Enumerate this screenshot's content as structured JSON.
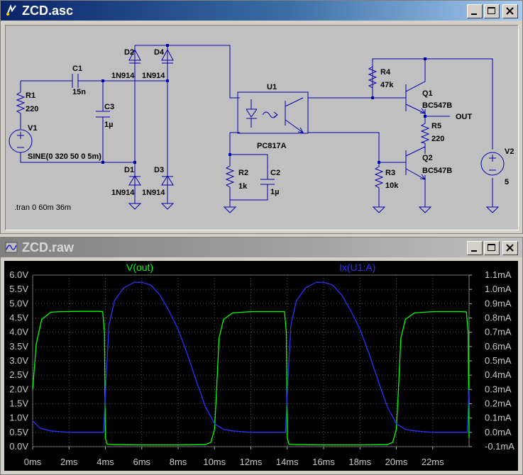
{
  "schematic_window": {
    "title": "ZCD.asc",
    "components": {
      "r1": {
        "name": "R1",
        "value": "220"
      },
      "v1": {
        "name": "V1",
        "value": "SINE(0 320 50 0 5m)"
      },
      "c1": {
        "name": "C1",
        "value": "15n"
      },
      "c3": {
        "name": "C3",
        "value": "1µ"
      },
      "d1": {
        "name": "D1",
        "value": "1N914"
      },
      "d2": {
        "name": "D2",
        "value": "1N914"
      },
      "d3": {
        "name": "D3",
        "value": "1N914"
      },
      "d4": {
        "name": "D4",
        "value": "1N914"
      },
      "u1": {
        "name": "U1",
        "value": "PC817A"
      },
      "r2": {
        "name": "R2",
        "value": "1k"
      },
      "c2": {
        "name": "C2",
        "value": "1µ"
      },
      "r3": {
        "name": "R3",
        "value": "10k"
      },
      "r4": {
        "name": "R4",
        "value": "47k"
      },
      "r5": {
        "name": "R5",
        "value": "220"
      },
      "q1": {
        "name": "Q1",
        "value": "BC547B"
      },
      "q2": {
        "name": "Q2",
        "value": "BC547B"
      },
      "v2": {
        "name": "V2",
        "value": "5"
      }
    },
    "net_label": "OUT",
    "directive": ".tran 0 60m 36m"
  },
  "waveform_window": {
    "title": "ZCD.raw",
    "trace_colors": {
      "vout": "#00ff00",
      "ix": "#3030ff"
    }
  },
  "chart_data": {
    "type": "line",
    "x_ticks": [
      "0ms",
      "2ms",
      "4ms",
      "6ms",
      "8ms",
      "10ms",
      "12ms",
      "14ms",
      "16ms",
      "18ms",
      "20ms",
      "22ms"
    ],
    "xlim": [
      0,
      24
    ],
    "left_axis": {
      "ylim": [
        0,
        6
      ],
      "ticks": [
        "0.0V",
        "0.5V",
        "1.0V",
        "1.5V",
        "2.0V",
        "2.5V",
        "3.0V",
        "3.5V",
        "4.0V",
        "4.5V",
        "5.0V",
        "5.5V",
        "6.0V"
      ]
    },
    "right_axis": {
      "ylim": [
        -0.1,
        1.1
      ],
      "ticks": [
        "-0.1mA",
        "0.0mA",
        "0.1mA",
        "0.2mA",
        "0.3mA",
        "0.4mA",
        "0.5mA",
        "0.6mA",
        "0.7mA",
        "0.8mA",
        "0.9mA",
        "1.0mA",
        "1.1mA"
      ]
    },
    "series": [
      {
        "name": "V(out)",
        "axis": "left",
        "color": "#00ff00",
        "points": [
          [
            0,
            2.0
          ],
          [
            0.2,
            3.6
          ],
          [
            0.5,
            4.45
          ],
          [
            1.0,
            4.7
          ],
          [
            1.5,
            4.72
          ],
          [
            2.5,
            4.73
          ],
          [
            3.6,
            4.73
          ],
          [
            3.85,
            4.72
          ],
          [
            3.95,
            4.0
          ],
          [
            4.0,
            0.3
          ],
          [
            4.1,
            0.08
          ],
          [
            4.6,
            0.07
          ],
          [
            6,
            0.06
          ],
          [
            8,
            0.06
          ],
          [
            9.5,
            0.07
          ],
          [
            9.8,
            0.15
          ],
          [
            10.0,
            0.6
          ],
          [
            10.1,
            1.8
          ],
          [
            10.25,
            3.8
          ],
          [
            10.5,
            4.45
          ],
          [
            11.0,
            4.68
          ],
          [
            12,
            4.72
          ],
          [
            13.5,
            4.72
          ],
          [
            13.85,
            4.72
          ],
          [
            13.95,
            4.0
          ],
          [
            14.0,
            0.3
          ],
          [
            14.1,
            0.08
          ],
          [
            14.6,
            0.07
          ],
          [
            16,
            0.06
          ],
          [
            18,
            0.06
          ],
          [
            19.5,
            0.07
          ],
          [
            19.8,
            0.15
          ],
          [
            20.0,
            0.6
          ],
          [
            20.1,
            1.8
          ],
          [
            20.25,
            3.8
          ],
          [
            20.5,
            4.45
          ],
          [
            21.0,
            4.68
          ],
          [
            22,
            4.72
          ],
          [
            23.6,
            4.72
          ],
          [
            23.85,
            4.71
          ],
          [
            23.95,
            4.0
          ],
          [
            24.0,
            0.3
          ]
        ]
      },
      {
        "name": "Ix(U1:A)",
        "axis": "right",
        "color": "#3030ff",
        "points": [
          [
            0,
            0.08
          ],
          [
            0.4,
            0.03
          ],
          [
            1.0,
            0.01
          ],
          [
            2,
            0.0
          ],
          [
            3.5,
            0.0
          ],
          [
            3.9,
            0.0
          ],
          [
            4.05,
            0.4
          ],
          [
            4.2,
            0.75
          ],
          [
            4.5,
            0.92
          ],
          [
            5,
            1.01
          ],
          [
            5.6,
            1.05
          ],
          [
            6,
            1.05
          ],
          [
            6.5,
            1.03
          ],
          [
            7,
            0.96
          ],
          [
            7.5,
            0.85
          ],
          [
            8,
            0.72
          ],
          [
            8.5,
            0.55
          ],
          [
            9,
            0.36
          ],
          [
            9.5,
            0.18
          ],
          [
            10,
            0.06
          ],
          [
            10.5,
            0.02
          ],
          [
            11,
            0.01
          ],
          [
            12,
            0.0
          ],
          [
            13.5,
            0.0
          ],
          [
            13.9,
            0.0
          ],
          [
            14.05,
            0.4
          ],
          [
            14.2,
            0.75
          ],
          [
            14.5,
            0.92
          ],
          [
            15,
            1.01
          ],
          [
            15.6,
            1.05
          ],
          [
            16,
            1.05
          ],
          [
            16.5,
            1.03
          ],
          [
            17,
            0.96
          ],
          [
            17.5,
            0.85
          ],
          [
            18,
            0.72
          ],
          [
            18.5,
            0.55
          ],
          [
            19,
            0.36
          ],
          [
            19.5,
            0.18
          ],
          [
            20,
            0.06
          ],
          [
            20.5,
            0.02
          ],
          [
            21,
            0.01
          ],
          [
            22,
            0.0
          ],
          [
            23.5,
            0.0
          ],
          [
            23.9,
            0.0
          ],
          [
            24,
            0.3
          ]
        ]
      }
    ]
  }
}
